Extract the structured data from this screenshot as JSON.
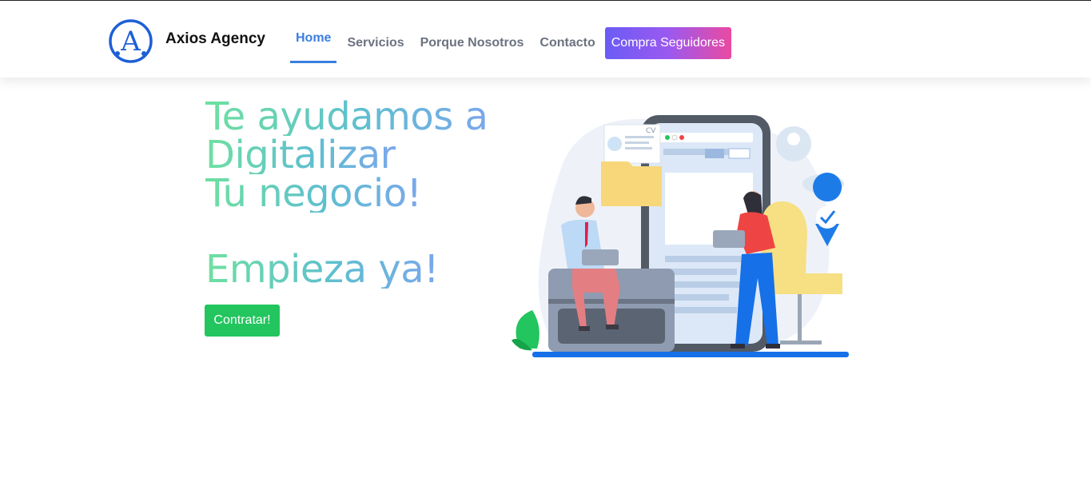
{
  "brand": {
    "name": "Axios Agency",
    "logo_letter": "A"
  },
  "nav": {
    "items": [
      {
        "label": "Home",
        "active": true
      },
      {
        "label": "Servicios"
      },
      {
        "label": "Porque Nosotros"
      },
      {
        "label": "Contacto"
      }
    ],
    "cta_label": "Compra Seguidores"
  },
  "hero": {
    "line1": "Te ayudamos a",
    "line2": "Digitalizar",
    "line3": "Tu negocio!",
    "line4": "Empieza ya!",
    "button_label": "Contratar!"
  },
  "illustration": {
    "cv_label": "CV"
  },
  "colors": {
    "accent": "#3b7fe0",
    "button_green": "#22c55e",
    "cta_gradient_start": "#6a5cf5",
    "cta_gradient_end": "#e94aa1"
  }
}
